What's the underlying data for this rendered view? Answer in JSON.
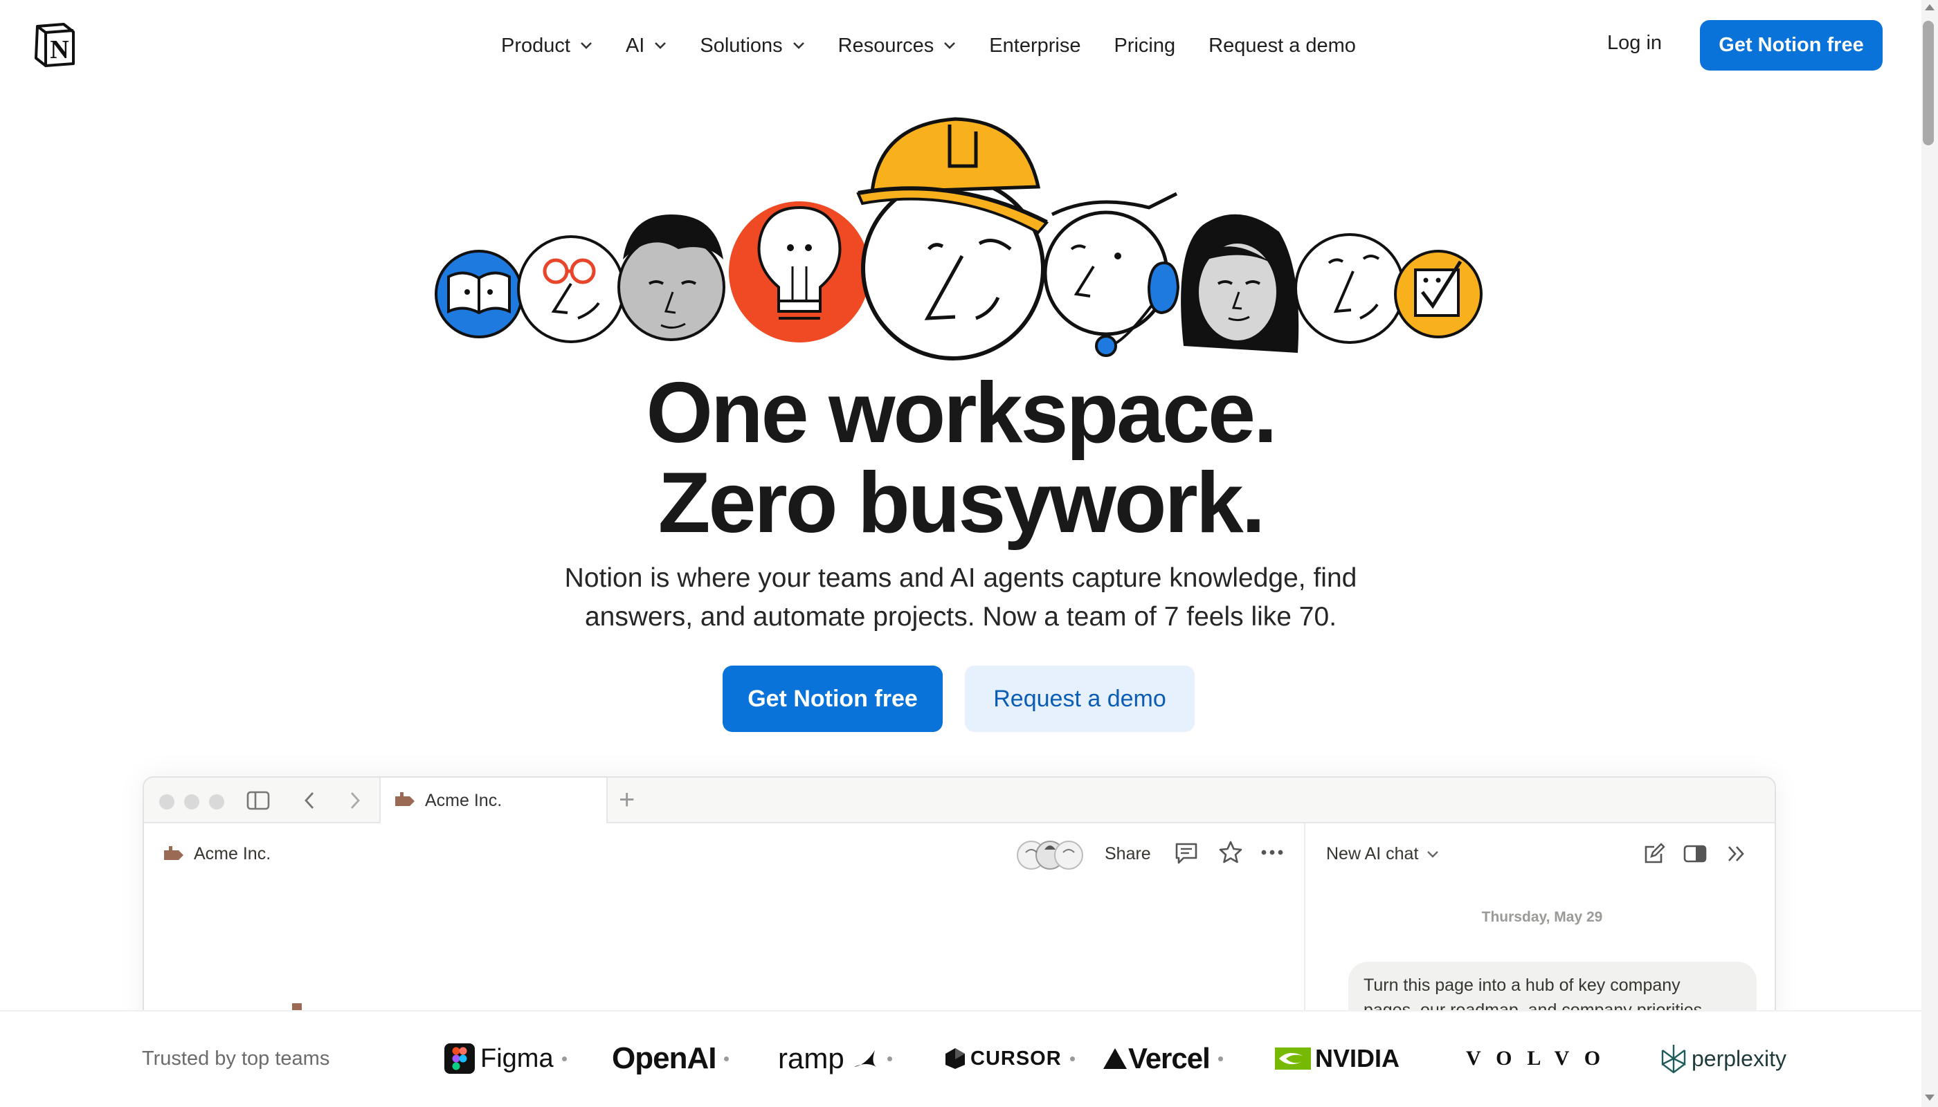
{
  "header": {
    "logo_letter": "N",
    "nav": [
      {
        "label": "Product",
        "dropdown": true
      },
      {
        "label": "AI",
        "dropdown": true
      },
      {
        "label": "Solutions",
        "dropdown": true
      },
      {
        "label": "Resources",
        "dropdown": true
      },
      {
        "label": "Enterprise",
        "dropdown": false
      },
      {
        "label": "Pricing",
        "dropdown": false
      },
      {
        "label": "Request a demo",
        "dropdown": false
      }
    ],
    "login_label": "Log in",
    "cta_label": "Get Notion free"
  },
  "hero": {
    "headline_line1": "One workspace.",
    "headline_line2": "Zero busywork.",
    "subtitle_line1": "Notion is where your teams and AI agents capture knowledge, find",
    "subtitle_line2": "answers, and automate projects. Now a team of 7 feels like 70.",
    "primary_cta": "Get Notion free",
    "secondary_cta": "Request a demo"
  },
  "app_window": {
    "tab_title": "Acme Inc.",
    "breadcrumb_title": "Acme Inc.",
    "share_label": "Share",
    "ai_chat_title": "New AI chat",
    "ai_date": "Thursday, May 29",
    "ai_message_line1": "Turn this page into a hub of key company",
    "ai_message_line2": "pages, our roadmap, and company priorities"
  },
  "logo_bar": {
    "trusted_label": "Trusted by top teams",
    "brands": [
      "Figma",
      "OpenAI",
      "ramp",
      "CURSOR",
      "Vercel",
      "NVIDIA",
      "VOLVO",
      "perplexity"
    ]
  },
  "colors": {
    "primary_blue": "#0a73d9",
    "secondary_blue_bg": "#e6f1fd",
    "page_icon_brown": "#9a6a55",
    "hardhat_yellow": "#f9b01d",
    "lightbulb_red": "#ef4a23",
    "headset_blue": "#1f7ae0"
  },
  "icons": {
    "logo": "notion-logo-icon",
    "page": "signpost-icon",
    "sidebar": "sidebar-toggle-icon",
    "back": "chevron-left-icon",
    "forward": "chevron-right-icon",
    "comment": "comment-icon",
    "favorite": "star-icon",
    "more": "more-horizontal-icon",
    "new_chat": "compose-icon",
    "panel": "panel-icon",
    "collapse": "double-chevron-right-icon"
  }
}
